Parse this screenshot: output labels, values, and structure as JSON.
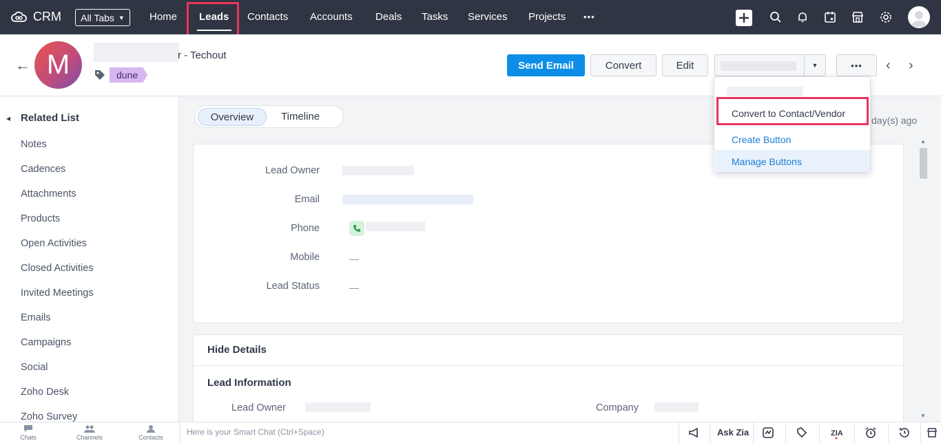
{
  "app": {
    "name": "CRM"
  },
  "nav": {
    "all_tabs": "All Tabs",
    "items": [
      "Home",
      "Leads",
      "Contacts",
      "Accounts",
      "Deals",
      "Tasks",
      "Services",
      "Projects"
    ],
    "more": "•••"
  },
  "record": {
    "avatar_letter": "M",
    "name_suffix": "r - Techout",
    "tag": "dune"
  },
  "actions": {
    "send_email": "Send Email",
    "convert": "Convert",
    "edit": "Edit",
    "more": "•••"
  },
  "menu": {
    "items": [
      "Convert to Contact/Vendor",
      "Create Button",
      "Manage Buttons"
    ]
  },
  "sidebar": {
    "title": "Related List",
    "items": [
      "Notes",
      "Cadences",
      "Attachments",
      "Products",
      "Open Activities",
      "Closed Activities",
      "Invited Meetings",
      "Emails",
      "Campaigns",
      "Social",
      "Zoho Desk",
      "Zoho Survey"
    ]
  },
  "tabs": {
    "overview": "Overview",
    "timeline": "Timeline"
  },
  "last_modified": "day(s) ago",
  "fields": {
    "lead_owner": "Lead Owner",
    "email": "Email",
    "phone": "Phone",
    "mobile": "Mobile",
    "lead_status": "Lead Status",
    "empty": "—"
  },
  "details": {
    "hide_details": "Hide Details",
    "lead_information": "Lead Information",
    "lead_owner": "Lead Owner",
    "company": "Company"
  },
  "bottombar": {
    "chats": "Chats",
    "channels": "Channels",
    "contacts": "Contacts",
    "smart_chat": "Here is your Smart Chat (Ctrl+Space)",
    "ask_zia": "Ask Zia"
  },
  "colors": {
    "nav_bg": "#2f3542",
    "primary": "#0c8ee8",
    "highlight": "#e9345a",
    "link": "#1a7fd6"
  }
}
